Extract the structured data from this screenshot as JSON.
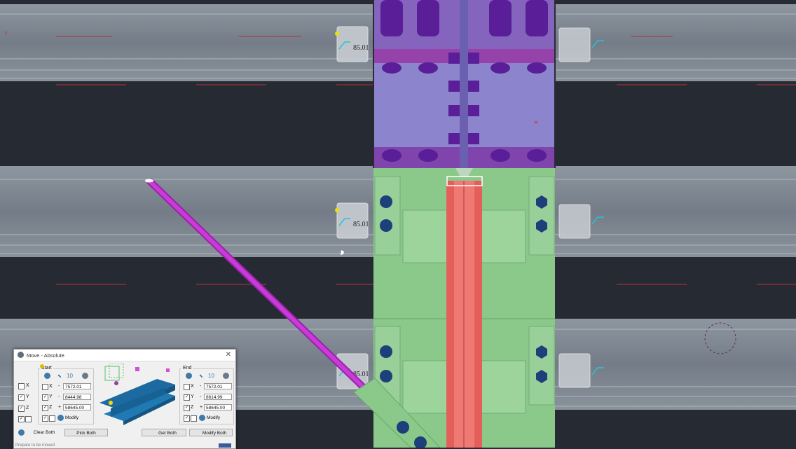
{
  "viewport": {
    "dimension_labels": [
      "85.01",
      "85.01",
      "85.01"
    ]
  },
  "colors": {
    "background": "#252a33",
    "beam": "#7f8893",
    "plate_purple": "#8c84cc",
    "bolt_purple": "#6a2aa0",
    "plate_green": "#8ac98a",
    "member_red": "#e55f5a",
    "brace_magenta": "#c02ad0",
    "bolt_blue": "#1d3f7a"
  },
  "dialog": {
    "title": "Move - Absolute",
    "close_glyph": "✕",
    "start": {
      "group_label": "Start",
      "pick_value": "10",
      "axes": [
        "X",
        "Y",
        "Z"
      ],
      "signs": [
        "-",
        "-",
        "+"
      ],
      "values": [
        "7572.01",
        "8444.98",
        "58645.00"
      ],
      "modify_label": "Modify"
    },
    "end": {
      "group_label": "End",
      "pick_value": "10",
      "axes": [
        "X",
        "Y",
        "Z"
      ],
      "signs": [
        "-",
        "-",
        "+"
      ],
      "values": [
        "7572.01",
        "8614.99",
        "58645.00"
      ],
      "modify_label": "Modify"
    },
    "side_axes": [
      "X",
      "Y",
      "Z"
    ],
    "buttons": {
      "clear_both": "Clear Both",
      "pick_both": "Pick Both",
      "get_both": "Get Both",
      "modify_both": "Modify Both"
    },
    "status_text": "Prepare to be moved"
  }
}
